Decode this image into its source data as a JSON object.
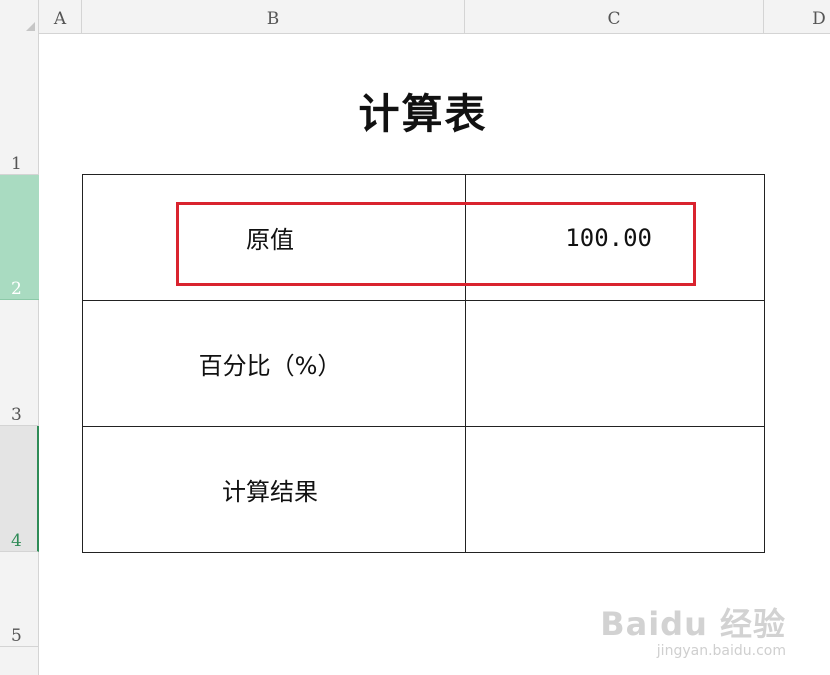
{
  "columns": [
    "A",
    "B",
    "C",
    "D"
  ],
  "rows": [
    "1",
    "2",
    "3",
    "4",
    "5"
  ],
  "sheet": {
    "title": "计算表",
    "table": [
      {
        "label": "原值",
        "value": "100.00"
      },
      {
        "label": "百分比（%）",
        "value": ""
      },
      {
        "label": "计算结果",
        "value": ""
      }
    ]
  },
  "selected_row": "2",
  "colors": {
    "selected_row_header": "#a9dbc1",
    "highlight_border": "#d9232e",
    "header_bg": "#f3f3f3"
  },
  "watermark": {
    "main": "Baidu 经验",
    "sub": "jingyan.baidu.com"
  }
}
